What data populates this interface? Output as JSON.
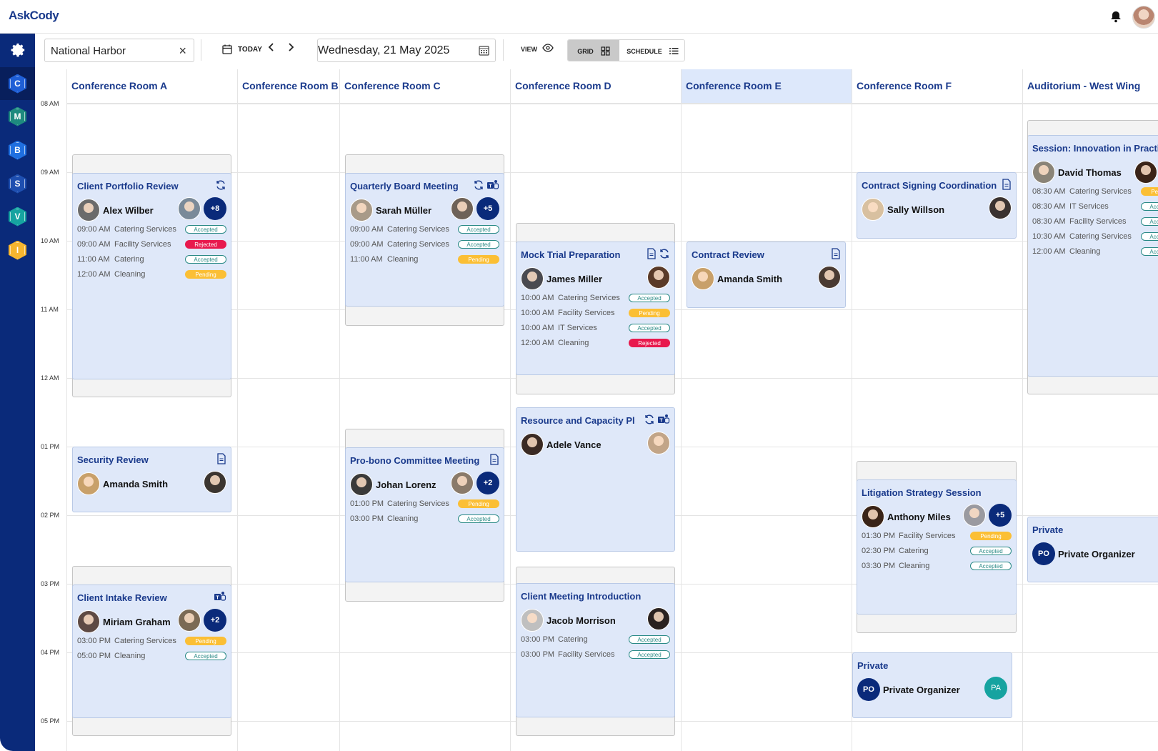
{
  "app": {
    "logo": "AskCody"
  },
  "sidebar": {
    "items": [
      {
        "letter": "C",
        "color": "#1f5fd6",
        "active": true
      },
      {
        "letter": "M",
        "color": "#1e8a7f",
        "active": false
      },
      {
        "letter": "B",
        "color": "#1f6fe0",
        "active": false
      },
      {
        "letter": "S",
        "color": "#1e4fb0",
        "active": false
      },
      {
        "letter": "V",
        "color": "#16a3a0",
        "active": false
      },
      {
        "letter": "I",
        "color": "#f6b52f",
        "active": false
      }
    ]
  },
  "toolbar": {
    "location": "National Harbor",
    "today": "TODAY",
    "date": "Wednesday, 21 May 2025",
    "view": "VIEW",
    "grid": "GRID",
    "schedule": "SCHEDULE"
  },
  "times": [
    "08 AM",
    "09 AM",
    "10 AM",
    "11 AM",
    "12 AM",
    "01 PM",
    "02 PM",
    "03 PM",
    "04 PM",
    "05 PM"
  ],
  "rooms": [
    "Conference Room A",
    "Conference Room B",
    "Conference Room C",
    "Conference Room D",
    "Conference Room E",
    "Conference Room F",
    "Auditorium - West Wing"
  ],
  "events": [
    {
      "title": "Client Portfolio Review",
      "organizer": "Alex Wilber",
      "more": "+8",
      "services": [
        [
          "09:00 AM",
          "Catering Services",
          "Accepted"
        ],
        [
          "09:00 AM",
          "Facility Services",
          "Rejected"
        ],
        [
          "11:00 AM",
          "Catering",
          "Accepted"
        ],
        [
          "12:00 AM",
          "Cleaning",
          "Pending"
        ]
      ]
    },
    {
      "title": "Security Review",
      "organizer": "Amanda Smith",
      "services": []
    },
    {
      "title": "Client Intake Review",
      "organizer": "Miriam Graham",
      "more": "+2",
      "services": [
        [
          "03:00 PM",
          "Catering Services",
          "Pending"
        ],
        [
          "05:00 PM",
          "Cleaning",
          "Accepted"
        ]
      ]
    },
    {
      "title": "Quarterly Board Meeting",
      "organizer": "Sarah Müller",
      "more": "+5",
      "services": [
        [
          "09:00 AM",
          "Catering Services",
          "Accepted"
        ],
        [
          "09:00 AM",
          "Catering Services",
          "Accepted"
        ],
        [
          "11:00 AM",
          "Cleaning",
          "Pending"
        ]
      ]
    },
    {
      "title": "Pro-bono Committee Meeting",
      "organizer": "Johan Lorenz",
      "more": "+2",
      "services": [
        [
          "01:00 PM",
          "Catering Services",
          "Pending"
        ],
        [
          "03:00 PM",
          "Cleaning",
          "Accepted"
        ]
      ]
    },
    {
      "title": "Mock Trial Preparation",
      "organizer": "James Miller",
      "services": [
        [
          "10:00 AM",
          "Catering Services",
          "Accepted"
        ],
        [
          "10:00 AM",
          "Facility Services",
          "Pending"
        ],
        [
          "10:00 AM",
          "IT Services",
          "Accepted"
        ],
        [
          "12:00 AM",
          "Cleaning",
          "Rejected"
        ]
      ]
    },
    {
      "title": "Resource and Capacity Pl...",
      "organizer": "Adele Vance",
      "services": []
    },
    {
      "title": "Client Meeting Introduction",
      "organizer": "Jacob Morrison",
      "services": [
        [
          "03:00 PM",
          "Catering",
          "Accepted"
        ],
        [
          "03:00 PM",
          "Facility Services",
          "Accepted"
        ]
      ]
    },
    {
      "title": "Contract Review",
      "organizer": "Amanda Smith",
      "services": []
    },
    {
      "title": "Contract Signing Coordination",
      "organizer": "Sally Willson",
      "services": []
    },
    {
      "title": "Litigation Strategy Session",
      "organizer": "Anthony Miles",
      "more": "+5",
      "services": [
        [
          "01:30 PM",
          "Facility Services",
          "Pending"
        ],
        [
          "02:30 PM",
          "Catering",
          "Accepted"
        ],
        [
          "03:30 PM",
          "Cleaning",
          "Accepted"
        ]
      ]
    },
    {
      "title": "Private",
      "organizer": "Private Organizer",
      "initials": "PO",
      "attendee_initials": "PA",
      "services": []
    },
    {
      "title": "Session: Innovation in Practice",
      "organizer": "David Thomas",
      "services": [
        [
          "08:30 AM",
          "Catering Services",
          "Pending"
        ],
        [
          "08:30 AM",
          "IT Services",
          "Accepted"
        ],
        [
          "08:30 AM",
          "Facility Services",
          "Accepted"
        ],
        [
          "10:30 AM",
          "Catering Services",
          "Accepted"
        ],
        [
          "12:00 AM",
          "Cleaning",
          "Accepted"
        ]
      ]
    },
    {
      "title": "Private",
      "organizer": "Private Organizer",
      "initials": "PO",
      "services": []
    }
  ]
}
